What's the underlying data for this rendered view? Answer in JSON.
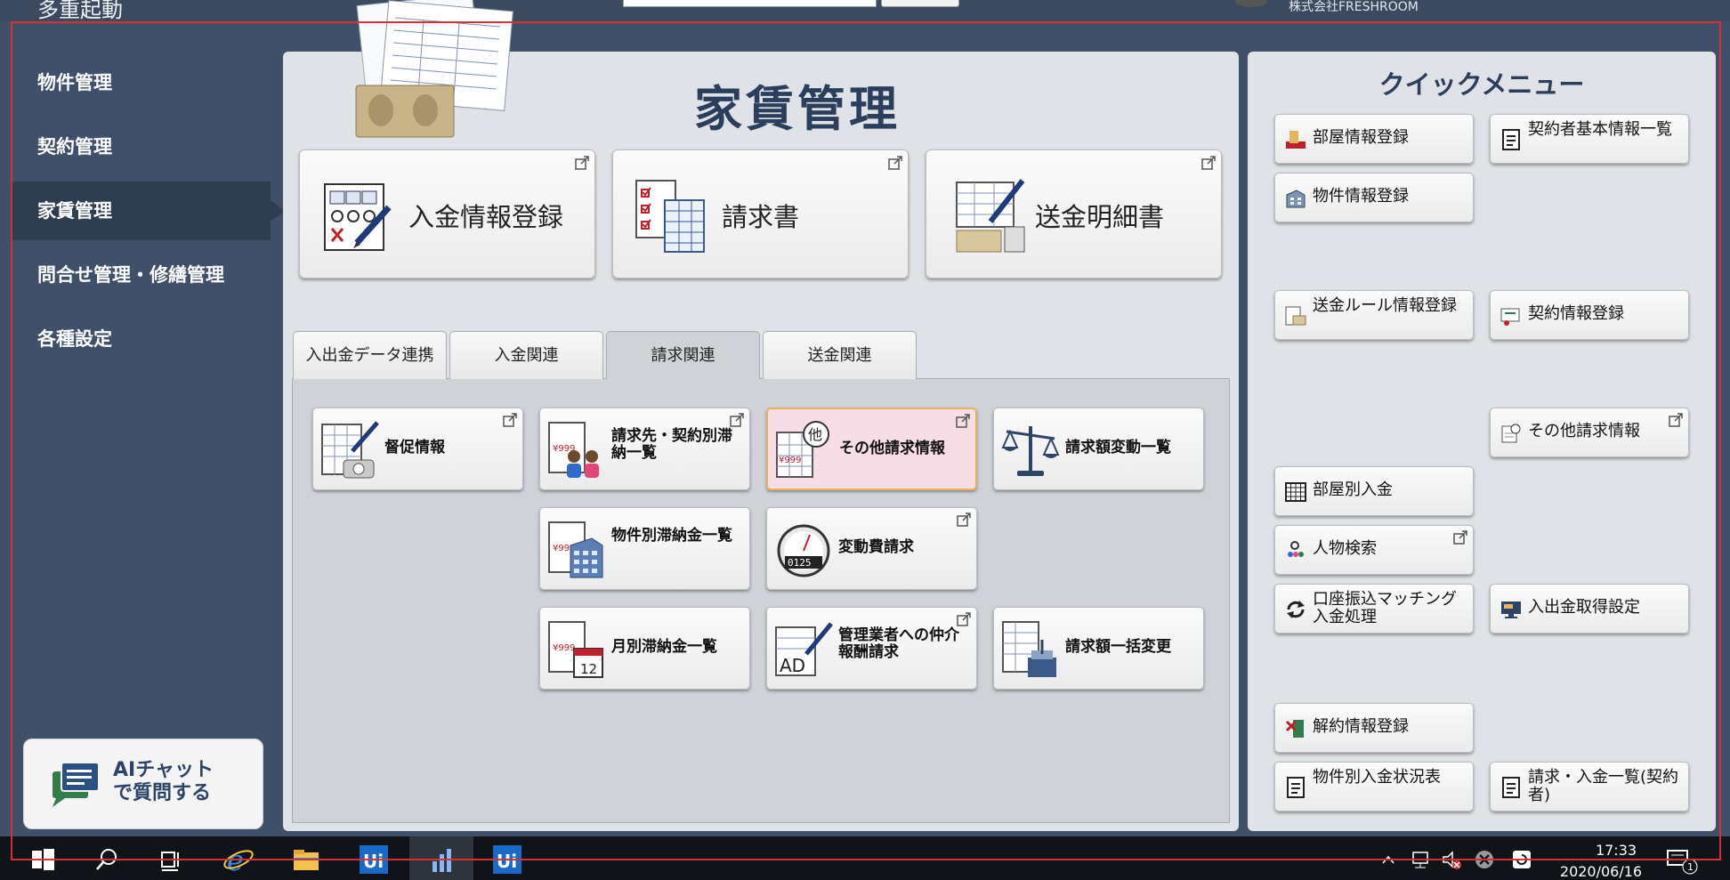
{
  "top_bar": {
    "title_fragment": "多重起動",
    "company": "株式会社FRESHROOM"
  },
  "sidebar": {
    "items": [
      {
        "label": "物件管理"
      },
      {
        "label": "契約管理"
      },
      {
        "label": "家賃管理",
        "active": true
      },
      {
        "label": "問合せ管理・修繕管理"
      },
      {
        "label": "各種設定"
      }
    ],
    "ai_chat": "AIチャット\nで質問する"
  },
  "main": {
    "title": "家賃管理",
    "big_cards": [
      {
        "label": "入金情報登録",
        "icon": "payment-grid-icon"
      },
      {
        "label": "請求書",
        "icon": "invoice-icon"
      },
      {
        "label": "送金明細書",
        "icon": "remittance-statement-icon"
      }
    ],
    "tabs": [
      {
        "label": "入出金データ連携"
      },
      {
        "label": "入金関連"
      },
      {
        "label": "請求関連",
        "active": true
      },
      {
        "label": "送金関連"
      }
    ],
    "tab_cards": [
      {
        "label": "督促情報",
        "icon": "reminder-phone-icon"
      },
      {
        "label": "請求先・契約別滞納一覧",
        "icon": "arrears-people-icon"
      },
      {
        "label": "その他請求情報",
        "icon": "other-billing-icon",
        "highlight": true
      },
      {
        "label": "請求額変動一覧",
        "icon": "scale-icon"
      },
      {
        "label": "物件別滞納金一覧",
        "icon": "building-arrears-icon"
      },
      {
        "label": "変動費請求",
        "icon": "meter-icon",
        "meter": "0125"
      },
      {
        "label": "月別滞納金一覧",
        "icon": "calendar-arrears-icon",
        "calendar_day": "12"
      },
      {
        "label": "管理業者への仲介報酬請求",
        "icon": "ad-fee-icon",
        "badge": "AD"
      },
      {
        "label": "請求額一括変更",
        "icon": "bulk-change-icon"
      }
    ]
  },
  "quick_menu": {
    "title": "クイックメニュー",
    "items": [
      {
        "label": "部屋情報登録",
        "icon": "room-icon"
      },
      {
        "label": "契約者基本情報一覧",
        "icon": "document-icon"
      },
      {
        "label": "物件情報登録",
        "icon": "building-icon"
      },
      {
        "label": "送金ルール情報登録",
        "icon": "remit-rule-icon"
      },
      {
        "label": "契約情報登録",
        "icon": "contract-icon"
      },
      {
        "label": "その他請求情報",
        "icon": "other-billing-small-icon"
      },
      {
        "label": "部屋別入金",
        "icon": "grid-icon"
      },
      {
        "label": "人物検索",
        "icon": "people-search-icon"
      },
      {
        "label": "口座振込マッチング入金処理",
        "icon": "refresh-icon"
      },
      {
        "label": "入出金取得設定",
        "icon": "monitor-icon"
      },
      {
        "label": "解約情報登録",
        "icon": "cancel-contract-icon"
      },
      {
        "label": "物件別入金状況表",
        "icon": "document-icon"
      },
      {
        "label": "請求・入金一覧(契約者)",
        "icon": "document-icon"
      }
    ]
  },
  "taskbar": {
    "apps": [
      "start-icon",
      "search-icon",
      "task-view-icon",
      "internet-explorer-icon",
      "file-explorer-icon",
      "uipath-icon",
      "chart-app-icon",
      "uipath-icon"
    ],
    "time": "17:33",
    "date": "2020/06/16",
    "notification_count": "1"
  },
  "colors": {
    "background": "#3f5068",
    "panel": "#dfe2e6",
    "title": "#2b3f5c",
    "highlight_card": "#f6dde6",
    "frame": "#d23232"
  }
}
